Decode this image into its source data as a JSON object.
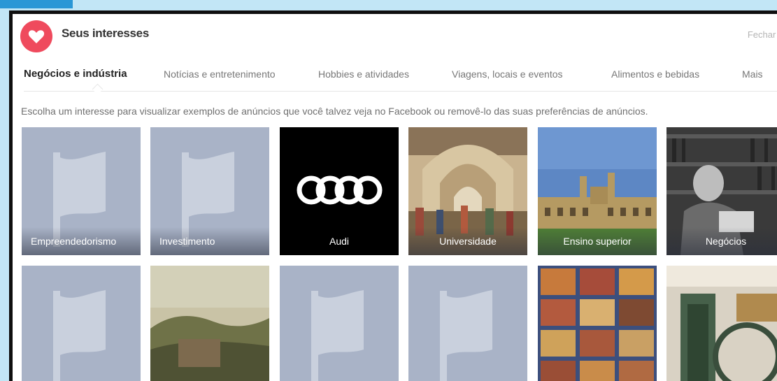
{
  "header": {
    "title": "Seus interesses",
    "close_label": "Fechar ^"
  },
  "tabs": [
    {
      "label": "Negócios e indústria",
      "active": true
    },
    {
      "label": "Notícias e entretenimento",
      "active": false
    },
    {
      "label": "Hobbies e atividades",
      "active": false
    },
    {
      "label": "Viagens, locais e eventos",
      "active": false
    },
    {
      "label": "Alimentos e bebidas",
      "active": false
    },
    {
      "label": "Mais",
      "active": false
    }
  ],
  "description": "Escolha um interesse para visualizar exemplos de anúncios que você talvez veja no Facebook ou removê-lo das suas preferências de anúncios.",
  "interests_row1": [
    {
      "label": "Empreendedorismo",
      "image": "flag-placeholder"
    },
    {
      "label": "Investimento",
      "image": "flag-placeholder"
    },
    {
      "label": "Audi",
      "image": "audi-logo"
    },
    {
      "label": "Universidade",
      "image": "painting-school-of-athens"
    },
    {
      "label": "Ensino superior",
      "image": "college-building-photo"
    },
    {
      "label": "Negócios",
      "image": "man-with-bookshelf-photo"
    }
  ],
  "interests_row2": [
    {
      "label": "",
      "image": "flag-placeholder"
    },
    {
      "label": "",
      "image": "landscape-painting"
    },
    {
      "label": "",
      "image": "flag-placeholder"
    },
    {
      "label": "",
      "image": "flag-placeholder"
    },
    {
      "label": "",
      "image": "medieval-tiles-artwork"
    },
    {
      "label": "",
      "image": "steam-engine-photo"
    }
  ],
  "colors": {
    "accent": "#ef4a5d",
    "placeholder_tile": "#a9b3c7",
    "background": "#c2e6f6"
  }
}
